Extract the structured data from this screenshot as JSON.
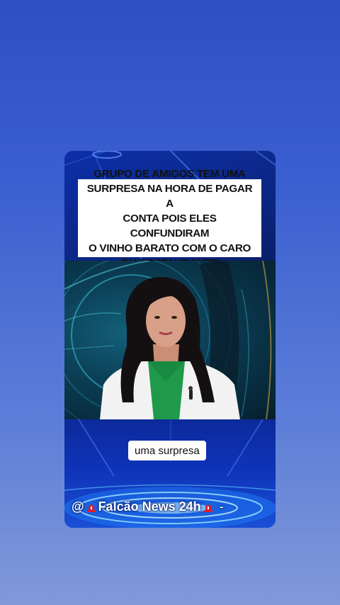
{
  "headline": {
    "text": "GRUPO DE AMIGOS TEM UMA\nSURPRESA NA HORA DE PAGAR A\nCONTA POIS ELES CONFUNDIRAM\nO VINHO BARATO COM O CARO\nEM RESTAURANTE"
  },
  "caption": {
    "text": "uma surpresa"
  },
  "brand": {
    "prefix": "@",
    "name": "Falcão News 24h",
    "suffix": "-",
    "icon": "siren-icon"
  },
  "colors": {
    "background_top": "#2d4fc4",
    "background_bottom": "#8298d9",
    "card_blue": "#0e33b8",
    "blouse_green": "#1f9a4a",
    "jacket_white": "#f2f2f2",
    "siren_red": "#e01e2a"
  }
}
